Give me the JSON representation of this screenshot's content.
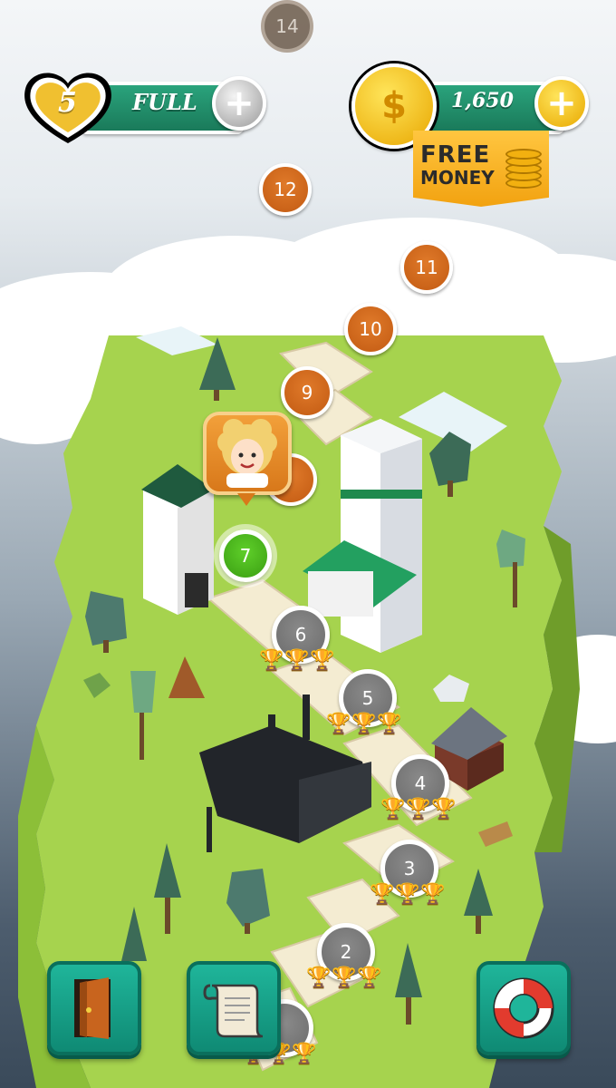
{
  "hud": {
    "lives_count": "5",
    "lives_status": "FULL",
    "coins": "1,650",
    "free_money_line1": "FREE",
    "free_money_line2": "MONEY"
  },
  "levels": [
    {
      "number": "14",
      "state": "locked"
    },
    {
      "number": "12",
      "state": "available"
    },
    {
      "number": "11",
      "state": "available"
    },
    {
      "number": "10",
      "state": "available"
    },
    {
      "number": "9",
      "state": "available"
    },
    {
      "number": "7",
      "state": "current"
    },
    {
      "number": "6",
      "state": "completed",
      "trophies": 3
    },
    {
      "number": "5",
      "state": "completed",
      "trophies": 3
    },
    {
      "number": "4",
      "state": "completed",
      "trophies": 3
    },
    {
      "number": "3",
      "state": "completed",
      "trophies": 3
    },
    {
      "number": "2",
      "state": "completed",
      "trophies": 3
    }
  ],
  "bottom_buttons": [
    "exit-door",
    "level-scroll",
    "help-lifebuoy"
  ],
  "colors": {
    "accent_green": "#1a8f6a",
    "gold": "#f2b010",
    "level_available": "#d06a1a",
    "level_completed": "#7a7a7a",
    "level_current": "#4cb81e",
    "grass": "#a6d34e"
  }
}
